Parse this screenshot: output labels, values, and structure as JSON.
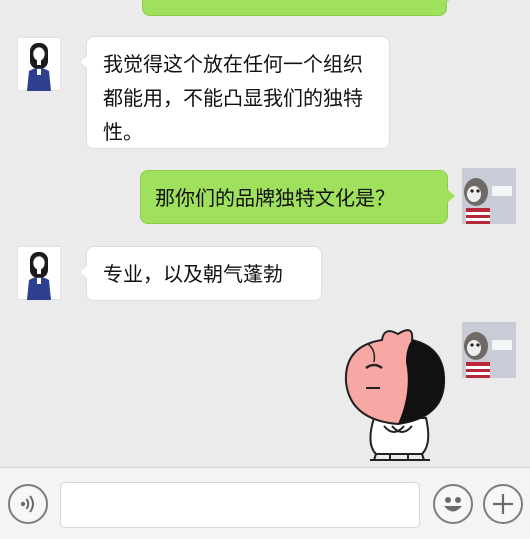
{
  "messages": [
    {
      "side": "in",
      "text": "我觉得这个放在任何一个组织都能用，不能凸显我们的独特性。"
    },
    {
      "side": "out",
      "text": "那你们的品牌独特文化是？"
    },
    {
      "side": "in",
      "text": "专业，以及朝气蓬勃"
    }
  ],
  "colors": {
    "bubble_out": "#9fe05c",
    "bubble_in": "#ffffff",
    "background": "#ebebeb"
  },
  "icons": {
    "voice": "voice-icon",
    "emoji": "emoji-icon",
    "plus": "plus-icon",
    "sticker": "peach-sticker"
  }
}
